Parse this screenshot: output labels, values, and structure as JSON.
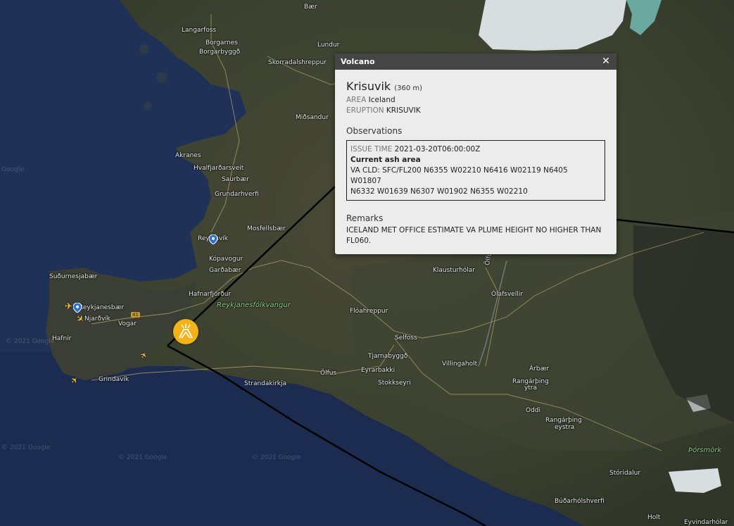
{
  "map": {
    "places": [
      {
        "id": "baer",
        "label": "Bær"
      },
      {
        "id": "langarfoss",
        "label": "Langarfoss"
      },
      {
        "id": "borgarnes",
        "label": "Borgarnes"
      },
      {
        "id": "borgarbyggd",
        "label": "Borgarbyggð"
      },
      {
        "id": "lundur",
        "label": "Lundur"
      },
      {
        "id": "skorradalshreppur",
        "label": "Skorradalshreppur"
      },
      {
        "id": "midsandur",
        "label": "Miðsandur"
      },
      {
        "id": "akranes",
        "label": "Akranes"
      },
      {
        "id": "hvalfjardarsveit",
        "label": "Hvalfjarðarsveit"
      },
      {
        "id": "saurbaer",
        "label": "Saurbær"
      },
      {
        "id": "grundarhverfi",
        "label": "Grundarhverfi"
      },
      {
        "id": "mosfellsbaer",
        "label": "Mosfellsbær"
      },
      {
        "id": "reykjavik",
        "label": "Reykjavík"
      },
      {
        "id": "kopavogur",
        "label": "Kópavogur"
      },
      {
        "id": "gardabaer",
        "label": "Garðabær"
      },
      {
        "id": "hafnarfjordur",
        "label": "Hafnarfjörður"
      },
      {
        "id": "sudurnesjabaer",
        "label": "Suðurnesjabær"
      },
      {
        "id": "reykjanesbaer",
        "label": "Reykjanesbær"
      },
      {
        "id": "njardvik",
        "label": "Njarðvík"
      },
      {
        "id": "vogar",
        "label": "Vogar"
      },
      {
        "id": "hafnir",
        "label": "Hafnir"
      },
      {
        "id": "grindavik",
        "label": "Grindavík"
      },
      {
        "id": "strandakirkja",
        "label": "Strandakirkja"
      },
      {
        "id": "olfus",
        "label": "Ölfus"
      },
      {
        "id": "eyrarbakki",
        "label": "Eyrarbakki"
      },
      {
        "id": "stokkseyri",
        "label": "Stokkseyri"
      },
      {
        "id": "tjarnabyggd",
        "label": "Tjarnabyggð"
      },
      {
        "id": "selfoss",
        "label": "Selfoss"
      },
      {
        "id": "floahreppur",
        "label": "Flóahreppur"
      },
      {
        "id": "villingaholt",
        "label": "Villingaholt"
      },
      {
        "id": "klausturholar",
        "label": "Klausturhólar"
      },
      {
        "id": "olafsvellir",
        "label": "Ólafsvellir"
      },
      {
        "id": "arbaer",
        "label": "Árbær"
      },
      {
        "id": "rangarbing_ytra_1",
        "label": "Rangárþing"
      },
      {
        "id": "rangarbing_ytra_2",
        "label": "ytra"
      },
      {
        "id": "oddi",
        "label": "Oddi"
      },
      {
        "id": "rangarbing_eystra_1",
        "label": "Rangárþing"
      },
      {
        "id": "rangarbing_eystra_2",
        "label": "eystra"
      },
      {
        "id": "storidalur",
        "label": "Stóridalur"
      },
      {
        "id": "budarholshverfi",
        "label": "Búðarhólshverfi"
      },
      {
        "id": "holt",
        "label": "Holt"
      },
      {
        "id": "eyvindarholar",
        "label": "Eyvindarhólar"
      },
      {
        "id": "olfusa",
        "label": "Ölfusá"
      }
    ],
    "parks": [
      {
        "id": "reykjanesfolkvangur",
        "label": "Reykjanesfólkvangur"
      },
      {
        "id": "thorsmork",
        "label": "Þórsmörk"
      }
    ],
    "road_shield": "41",
    "copyright": [
      "© 2021 Google",
      "© 2021 Google",
      "© 2021 Google",
      "© 2021 Google",
      "Google"
    ],
    "colors": {
      "volcano_marker": "#f3b21a",
      "advisory_line": "#000000",
      "ocean": "#1e3054"
    }
  },
  "popup": {
    "title": "Volcano",
    "close_glyph": "✕",
    "volcano_name": "Krisuvik",
    "elevation": "(360 m)",
    "area_key": "AREA",
    "area_value": "Iceland",
    "eruption_key": "ERUPTION",
    "eruption_value": "KRISUVIK",
    "observations_title": "Observations",
    "issue_time_key": "ISSUE TIME",
    "issue_time_value": "2021-03-20T06:00:00Z",
    "ash_area_title": "Current ash area",
    "ash_line_1": "VA CLD: SFC/FL200 N6355 W02210 N6416 W02119 N6405 W01807",
    "ash_line_2": "N6332 W01639 N6307 W01902 N6355 W02210",
    "remarks_title": "Remarks",
    "remarks_text": "ICELAND MET OFFICE ESTIMATE VA PLUME HEIGHT NO HIGHER THAN FL060."
  }
}
